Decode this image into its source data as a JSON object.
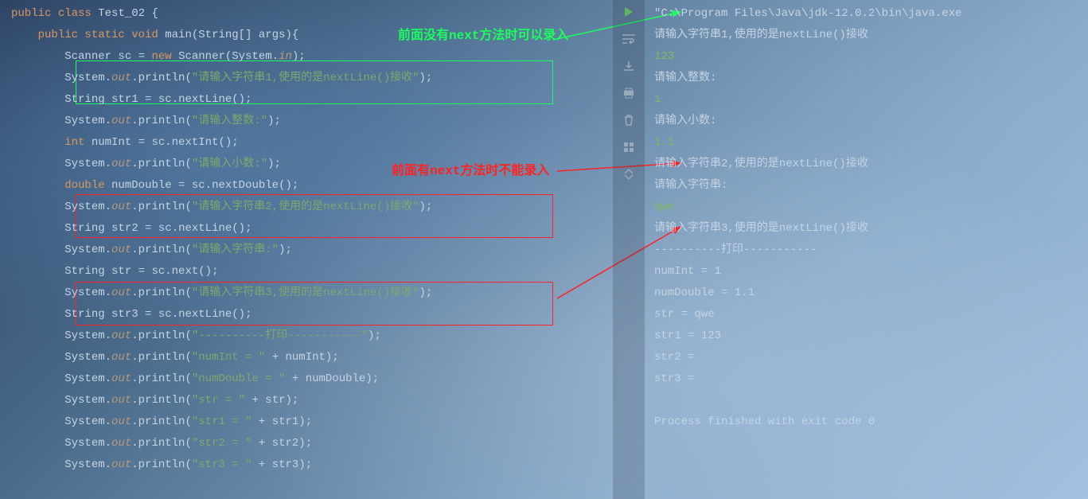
{
  "editor": {
    "lines": [
      {
        "tokens": [
          {
            "t": "public ",
            "c": "kw"
          },
          {
            "t": "class ",
            "c": "kw"
          },
          {
            "t": "Test_02 ",
            "c": "var"
          },
          {
            "t": "{",
            "c": "punct"
          }
        ],
        "indent": 0
      },
      {
        "tokens": [
          {
            "t": "public static void ",
            "c": "kw"
          },
          {
            "t": "main",
            "c": "var"
          },
          {
            "t": "(String[] args){",
            "c": "punct"
          }
        ],
        "indent": 4
      },
      {
        "tokens": [
          {
            "t": "Scanner sc ",
            "c": "var"
          },
          {
            "t": "= ",
            "c": "punct"
          },
          {
            "t": "new ",
            "c": "kw"
          },
          {
            "t": "Scanner(System.",
            "c": "var"
          },
          {
            "t": "in",
            "c": "it"
          },
          {
            "t": ");",
            "c": "punct"
          }
        ],
        "indent": 8
      },
      {
        "tokens": [
          {
            "t": "System.",
            "c": "var"
          },
          {
            "t": "out",
            "c": "it"
          },
          {
            "t": ".println(",
            "c": "var"
          },
          {
            "t": "\"请输入字符串1,使用的是nextLine()接收\"",
            "c": "str"
          },
          {
            "t": ");",
            "c": "punct"
          }
        ],
        "indent": 8
      },
      {
        "tokens": [
          {
            "t": "String str1 ",
            "c": "var"
          },
          {
            "t": "= ",
            "c": "punct"
          },
          {
            "t": "sc.nextLine();",
            "c": "var"
          }
        ],
        "indent": 8
      },
      {
        "tokens": [
          {
            "t": "System.",
            "c": "var"
          },
          {
            "t": "out",
            "c": "it"
          },
          {
            "t": ".println(",
            "c": "var"
          },
          {
            "t": "\"请输入整数:\"",
            "c": "str"
          },
          {
            "t": ");",
            "c": "punct"
          }
        ],
        "indent": 8
      },
      {
        "tokens": [
          {
            "t": "int ",
            "c": "kw"
          },
          {
            "t": "numInt ",
            "c": "var"
          },
          {
            "t": "= ",
            "c": "punct"
          },
          {
            "t": "sc.nextInt();",
            "c": "var"
          }
        ],
        "indent": 8
      },
      {
        "tokens": [
          {
            "t": "System.",
            "c": "var"
          },
          {
            "t": "out",
            "c": "it"
          },
          {
            "t": ".println(",
            "c": "var"
          },
          {
            "t": "\"请输入小数:\"",
            "c": "str"
          },
          {
            "t": ");",
            "c": "punct"
          }
        ],
        "indent": 8
      },
      {
        "tokens": [
          {
            "t": "double ",
            "c": "kw"
          },
          {
            "t": "numDouble ",
            "c": "var"
          },
          {
            "t": "= ",
            "c": "punct"
          },
          {
            "t": "sc.nextDouble();",
            "c": "var"
          }
        ],
        "indent": 8
      },
      {
        "tokens": [
          {
            "t": "System.",
            "c": "var"
          },
          {
            "t": "out",
            "c": "it"
          },
          {
            "t": ".println(",
            "c": "var"
          },
          {
            "t": "\"请输入字符串2,使用的是nextLine()接收\"",
            "c": "str"
          },
          {
            "t": ");",
            "c": "punct"
          }
        ],
        "indent": 8
      },
      {
        "tokens": [
          {
            "t": "String str2 ",
            "c": "var"
          },
          {
            "t": "= ",
            "c": "punct"
          },
          {
            "t": "sc.nextLine();",
            "c": "var"
          }
        ],
        "indent": 8
      },
      {
        "tokens": [
          {
            "t": "System.",
            "c": "var"
          },
          {
            "t": "out",
            "c": "it"
          },
          {
            "t": ".println(",
            "c": "var"
          },
          {
            "t": "\"请输入字符串:\"",
            "c": "str"
          },
          {
            "t": ");",
            "c": "punct"
          }
        ],
        "indent": 8
      },
      {
        "tokens": [
          {
            "t": "String str ",
            "c": "var"
          },
          {
            "t": "= ",
            "c": "punct"
          },
          {
            "t": "sc.next();",
            "c": "var"
          }
        ],
        "indent": 8
      },
      {
        "tokens": [
          {
            "t": "System.",
            "c": "var"
          },
          {
            "t": "out",
            "c": "it"
          },
          {
            "t": ".println(",
            "c": "var"
          },
          {
            "t": "\"请输入字符串3,使用的是nextLine()接收\"",
            "c": "str"
          },
          {
            "t": ");",
            "c": "punct"
          }
        ],
        "indent": 8
      },
      {
        "tokens": [
          {
            "t": "String str3 ",
            "c": "var"
          },
          {
            "t": "= ",
            "c": "punct"
          },
          {
            "t": "sc.nextLine();",
            "c": "var"
          }
        ],
        "indent": 8
      },
      {
        "tokens": [
          {
            "t": "System.",
            "c": "var"
          },
          {
            "t": "out",
            "c": "it"
          },
          {
            "t": ".println(",
            "c": "var"
          },
          {
            "t": "\"----------打印-----------\"",
            "c": "str"
          },
          {
            "t": ");",
            "c": "punct"
          }
        ],
        "indent": 8
      },
      {
        "tokens": [
          {
            "t": "System.",
            "c": "var"
          },
          {
            "t": "out",
            "c": "it"
          },
          {
            "t": ".println(",
            "c": "var"
          },
          {
            "t": "\"numInt = \"",
            "c": "str"
          },
          {
            "t": " + numInt);",
            "c": "punct"
          }
        ],
        "indent": 8
      },
      {
        "tokens": [
          {
            "t": "System.",
            "c": "var"
          },
          {
            "t": "out",
            "c": "it"
          },
          {
            "t": ".println(",
            "c": "var"
          },
          {
            "t": "\"numDouble = \"",
            "c": "str"
          },
          {
            "t": " + numDouble);",
            "c": "punct"
          }
        ],
        "indent": 8
      },
      {
        "tokens": [
          {
            "t": "System.",
            "c": "var"
          },
          {
            "t": "out",
            "c": "it"
          },
          {
            "t": ".println(",
            "c": "var"
          },
          {
            "t": "\"str = \"",
            "c": "str"
          },
          {
            "t": " + str);",
            "c": "punct"
          }
        ],
        "indent": 8
      },
      {
        "tokens": [
          {
            "t": "System.",
            "c": "var"
          },
          {
            "t": "out",
            "c": "it"
          },
          {
            "t": ".println(",
            "c": "var"
          },
          {
            "t": "\"str1 = \"",
            "c": "str"
          },
          {
            "t": " + str1);",
            "c": "punct"
          }
        ],
        "indent": 8
      },
      {
        "tokens": [
          {
            "t": "System.",
            "c": "var"
          },
          {
            "t": "out",
            "c": "it"
          },
          {
            "t": ".println(",
            "c": "var"
          },
          {
            "t": "\"str2 = \"",
            "c": "str"
          },
          {
            "t": " + str2);",
            "c": "punct"
          }
        ],
        "indent": 8
      },
      {
        "tokens": [
          {
            "t": "System.",
            "c": "var"
          },
          {
            "t": "out",
            "c": "it"
          },
          {
            "t": ".println(",
            "c": "var"
          },
          {
            "t": "\"str3 = \"",
            "c": "str"
          },
          {
            "t": " + str3);",
            "c": "punct"
          }
        ],
        "indent": 8
      }
    ]
  },
  "annotations": {
    "green_text": "前面没有next方法时可以录入",
    "red_text": "前面有next方法时不能录入"
  },
  "console": {
    "lines": [
      {
        "t": "\"C:\\Program Files\\Java\\jdk-12.0.2\\bin\\java.exe",
        "c": ""
      },
      {
        "t": "请输入字符串1,使用的是nextLine()接收",
        "c": ""
      },
      {
        "t": "123",
        "c": "g"
      },
      {
        "t": "请输入整数:",
        "c": ""
      },
      {
        "t": "1",
        "c": "g"
      },
      {
        "t": "请输入小数:",
        "c": ""
      },
      {
        "t": "1.1",
        "c": "g"
      },
      {
        "t": "请输入字符串2,使用的是nextLine()接收",
        "c": ""
      },
      {
        "t": "请输入字符串:",
        "c": ""
      },
      {
        "t": "qwe",
        "c": "g"
      },
      {
        "t": "请输入字符串3,使用的是nextLine()接收",
        "c": ""
      },
      {
        "t": "----------打印-----------",
        "c": ""
      },
      {
        "t": "numInt = 1",
        "c": ""
      },
      {
        "t": "numDouble = 1.1",
        "c": ""
      },
      {
        "t": "str = qwe",
        "c": ""
      },
      {
        "t": "str1 = 123",
        "c": ""
      },
      {
        "t": "str2 = ",
        "c": ""
      },
      {
        "t": "str3 = ",
        "c": ""
      },
      {
        "t": "",
        "c": ""
      },
      {
        "t": "Process finished with exit code 0",
        "c": ""
      }
    ]
  },
  "toolbar": {
    "icons": [
      "run",
      "wrap",
      "download",
      "print",
      "delete",
      "layout",
      "collapse"
    ]
  }
}
